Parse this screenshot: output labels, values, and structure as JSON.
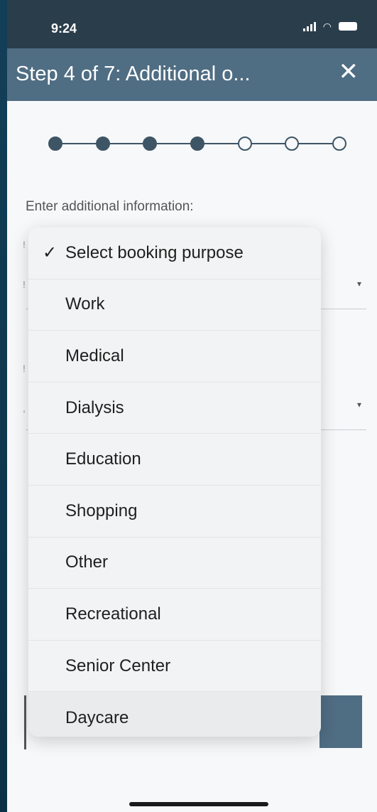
{
  "status_bar": {
    "time": "9:24"
  },
  "header": {
    "title": "Step 4 of 7: Additional o...",
    "close_glyph": "✕"
  },
  "stepper": {
    "total_steps": 7,
    "completed_steps": 4
  },
  "form": {
    "label": "Enter additional information:"
  },
  "dropdown": {
    "check_glyph": "✓",
    "selected_index": 0,
    "options": [
      "Select booking purpose",
      "Work",
      "Medical",
      "Dialysis",
      "Education",
      "Shopping",
      "Other",
      "Recreational",
      "Senior Center",
      "Daycare"
    ]
  },
  "colors": {
    "header_bg": "#4f6d83",
    "status_bar_bg": "#2a3d4b",
    "stepper": "#3e5566"
  }
}
